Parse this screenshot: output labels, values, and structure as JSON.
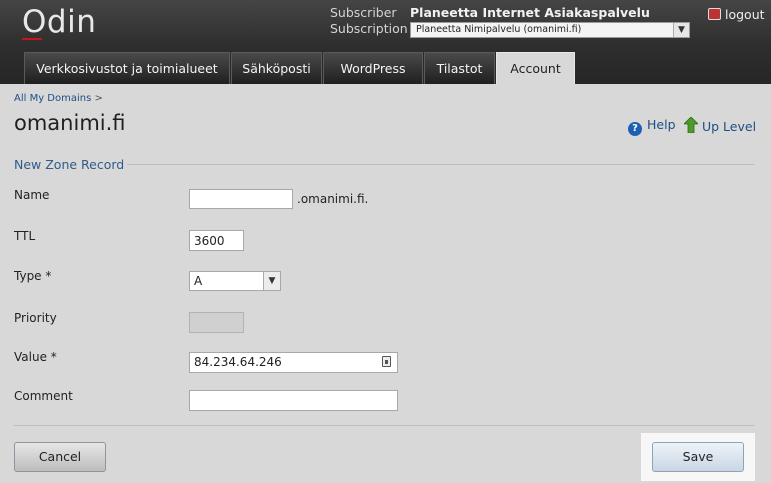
{
  "header": {
    "logo": "Odin",
    "subscriber_label": "Subscriber",
    "subscriber_value": "Planeetta Internet Asiakaspalvelu",
    "subscription_label": "Subscription",
    "subscription_value": "Planeetta Nimipalvelu (omanimi.fi)",
    "logout_label": "logout"
  },
  "tabs": [
    {
      "label": "Verkkosivustot ja toimialueet",
      "active": false
    },
    {
      "label": "Sähköposti",
      "active": false
    },
    {
      "label": "WordPress",
      "active": false
    },
    {
      "label": "Tilastot",
      "active": false
    },
    {
      "label": "Account",
      "active": true
    }
  ],
  "breadcrumb": {
    "link": "All My Domains",
    "separator": ">"
  },
  "page_title": "omanimi.fi",
  "actions": {
    "help": "Help",
    "up_level": "Up Level"
  },
  "section_title": "New Zone Record",
  "form": {
    "name_label": "Name",
    "name_value": "",
    "name_suffix": ".omanimi.fi.",
    "ttl_label": "TTL",
    "ttl_value": "3600",
    "type_label": "Type *",
    "type_value": "A",
    "priority_label": "Priority",
    "priority_value": "",
    "value_label": "Value *",
    "value_value": "84.234.64.246",
    "comment_label": "Comment",
    "comment_value": ""
  },
  "buttons": {
    "cancel": "Cancel",
    "save": "Save"
  }
}
